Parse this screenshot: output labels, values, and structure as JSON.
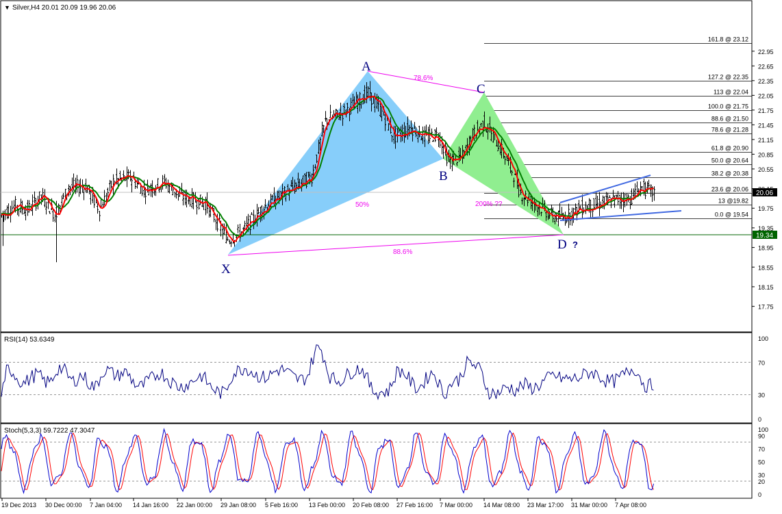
{
  "main_header": {
    "triangle": "▼",
    "title": "Silver,H4 20.01 20.09 19.96 20.06"
  },
  "rsi_header": "RSI(14) 53.6349",
  "stoch_header": "Stoch(5,3,3) 59.7222 47.3047",
  "pattern_labels": {
    "X": "X",
    "A": "A",
    "B": "B",
    "C": "C",
    "D": "D",
    "q": "?"
  },
  "pattern_ratios": {
    "xa_b": "50%",
    "ac": "78.6%",
    "bd": "200% ??",
    "xd": "88.6%"
  },
  "fib_levels": [
    {
      "label": "161.8 @ 23.12",
      "value": 23.12
    },
    {
      "label": "127.2 @ 22.35",
      "value": 22.35
    },
    {
      "label": "113 @ 22.04",
      "value": 22.04
    },
    {
      "label": "100.0 @ 21.75",
      "value": 21.75
    },
    {
      "label": "88.6 @ 21.50",
      "value": 21.5
    },
    {
      "label": "78.6 @ 21.28",
      "value": 21.28
    },
    {
      "label": "61.8 @ 20.90",
      "value": 20.9
    },
    {
      "label": "50.0 @ 20.64",
      "value": 20.64
    },
    {
      "label": "38.2 @ 20.38",
      "value": 20.38
    },
    {
      "label": "23.6 @ 20.06",
      "value": 20.06
    },
    {
      "label": "13 @19.82",
      "value": 19.82
    },
    {
      "label": "0.0 @ 19.54",
      "value": 19.54
    }
  ],
  "price_axis": [
    "22.95",
    "22.65",
    "22.35",
    "22.05",
    "21.75",
    "21.45",
    "21.15",
    "20.85",
    "20.55",
    "20.15",
    "19.75",
    "19.35",
    "18.95",
    "18.55",
    "18.15",
    "17.75"
  ],
  "current_price": "20.06",
  "support_price": "19.34",
  "rsi_axis": [
    "100",
    "70",
    "30",
    "0"
  ],
  "stoch_axis": [
    "100",
    "90",
    "70",
    "50",
    "30",
    "20",
    "0"
  ],
  "time_axis": [
    "19 Dec 2013",
    "30 Dec 00:00",
    "7 Jan 04:00",
    "14 Jan 16:00",
    "22 Jan 00:00",
    "29 Jan 08:00",
    "5 Feb 16:00",
    "13 Feb 00:00",
    "20 Feb 08:00",
    "27 Feb 16:00",
    "7 Mar 00:00",
    "14 Mar 08:00",
    "23 Mar 17:00",
    "31 Mar 00:00",
    "7 Apr 08:00"
  ],
  "colors": {
    "candles": "#000000",
    "ma_fast": "#ff0000",
    "ma_slow": "#008000",
    "ma_cross": "#ffff00",
    "xab_fill": "#87cefa",
    "bcd_fill": "#90ee90",
    "pattern_lines": "#ee00ee",
    "channel": "#4169e1",
    "rsi_line": "#000080",
    "stoch_main": "#0000cd",
    "stoch_signal": "#ff0000",
    "fib_lines": "#000000",
    "support_line": "#006400",
    "label_navy": "#000080"
  },
  "chart_data": [
    {
      "type": "candlestick",
      "series": [
        {
          "name": "Silver,H4",
          "open": 20.01,
          "high": 20.09,
          "low": 19.96,
          "close": 20.06
        }
      ],
      "pattern_points": [
        {
          "name": "X",
          "price": 19.02
        },
        {
          "name": "A",
          "price": 22.15
        },
        {
          "name": "B",
          "price": 20.6
        },
        {
          "name": "C",
          "price": 21.7
        },
        {
          "name": "D",
          "price": 19.34
        }
      ],
      "ylim": [
        17.55,
        23.25
      ]
    },
    {
      "type": "line",
      "series": [
        {
          "name": "RSI(14)",
          "last": 53.6349
        }
      ],
      "ylim": [
        0,
        100
      ],
      "levels": [
        70,
        30
      ]
    },
    {
      "type": "line",
      "series": [
        {
          "name": "Stoch main",
          "last": 59.7222
        },
        {
          "name": "Stoch signal",
          "last": 47.3047
        }
      ],
      "ylim": [
        0,
        100
      ],
      "levels": [
        80,
        20
      ]
    }
  ]
}
